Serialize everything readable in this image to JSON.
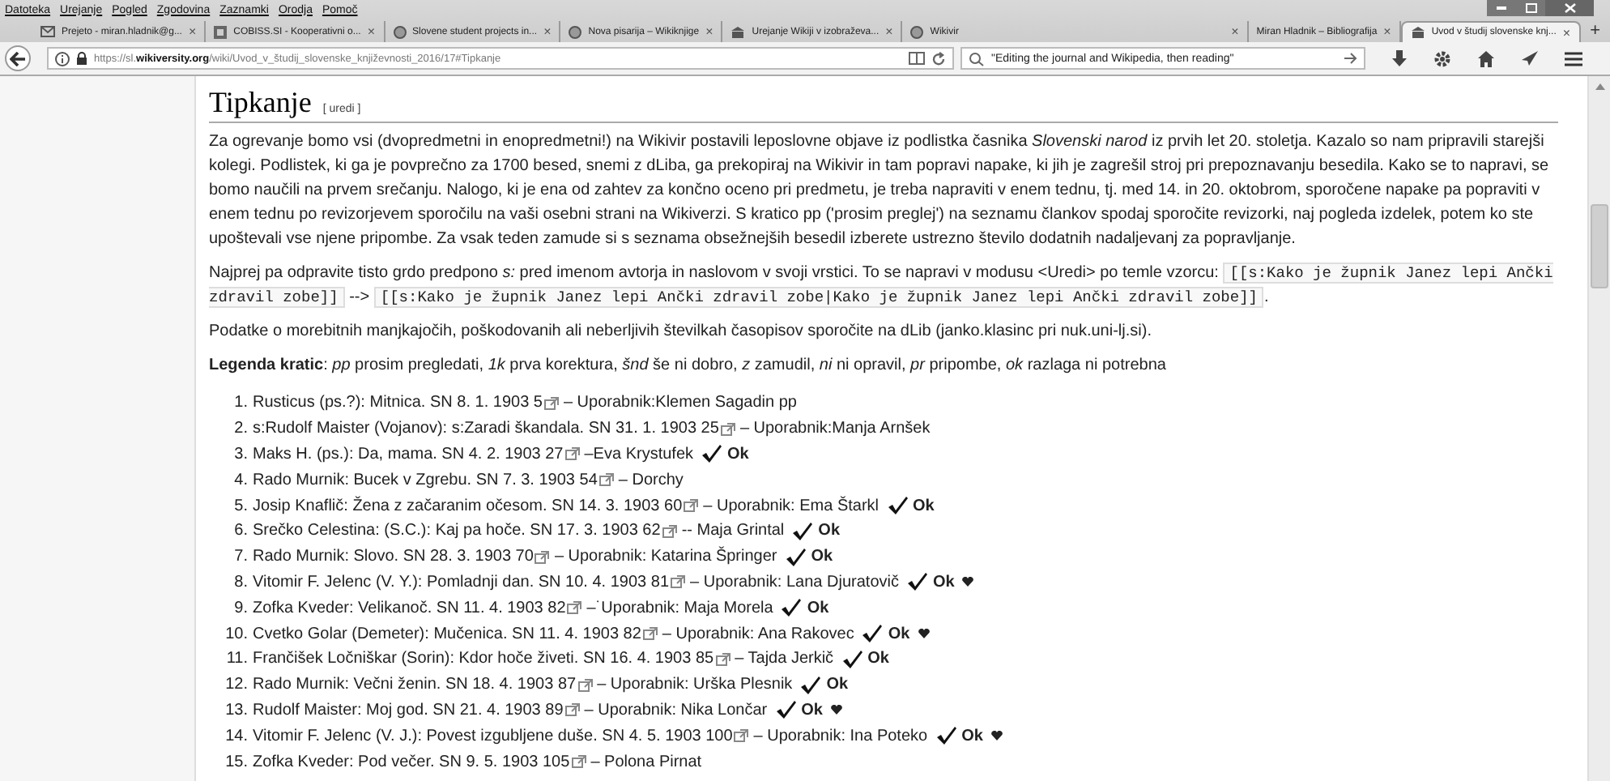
{
  "menu_bar": [
    "Datoteka",
    "Urejanje",
    "Pogled",
    "Zgodovina",
    "Zaznamki",
    "Orodja",
    "Pomoč"
  ],
  "tabs": [
    {
      "title": "Prejeto - miran.hladnik@g...",
      "selected": false
    },
    {
      "title": "COBISS.SI - Kooperativni o...",
      "selected": false
    },
    {
      "title": "Slovene student projects in...",
      "selected": false
    },
    {
      "title": "Nova pisarija – Wikiknjige",
      "selected": false
    },
    {
      "title": "Urejanje Wikiji v izobraževa...",
      "selected": false
    },
    {
      "title": "Wikivir",
      "selected": false
    },
    {
      "title": "Miran Hladnik – Bibliografija",
      "selected": false
    },
    {
      "title": "Uvod v študij slovenske knj...",
      "selected": true
    }
  ],
  "tab_close": "×",
  "new_tab": "+",
  "address_bar": {
    "url_host_prefix": "https://sl.",
    "url_host": "wikiversity.org",
    "url_path": "/wiki/Uvod_v_študij_slovenske_književnosti_2016/17#Tipkanje"
  },
  "search": {
    "value": "\"Editing the journal and Wikipedia, then reading\""
  },
  "section": {
    "title": "Tipkanje",
    "edit_link": "[ uredi ]"
  },
  "paragraphs": [
    [
      {
        "kind": "text",
        "text": "Za ogrevanje bomo vsi (dvopredmetni in enopredmetni!) na Wikivir postavili leposlovne objave iz podlistka časnika *Slovenski narod* iz prvih let 20. stoletja. Kazalo so nam pripravili starejši kolegi. Podlistek, ki ga je povprečno za 1700 besed, snemi z dLiba, ga prekopiraj na Wikivir in tam popravi napake, ki jih je zagrešil stroj pri prepoznavanju besedila. Kako se to napravi, se bomo naučili na prvem srečanju. Nalogo, ki je ena od zahtev za končno oceno pri predmetu, je treba napraviti v enem tednu, tj. med 14. in 20. oktobrom, sporočene napake pa popraviti v enem tednu po revizorjevem sporočilu na vaši osebni strani na Wikiverzi. S kratico pp ('prosim preglej') na seznamu člankov spodaj sporočite revizorki, naj pogleda izdelek, potem ko ste upoštevali vse njene pripombe. Za vsak teden zamude si s seznama obsežnejših besedil izberete ustrezno število dodatnih nadaljevanj za popravljanje."
      }
    ],
    [
      {
        "kind": "text",
        "text": "Najprej pa odpravite tisto grdo predpono *s:* pred imenom avtorja in naslovom v svoji vrstici. To se napravi v modusu <Uredi> po temle vzorcu: "
      },
      {
        "kind": "code",
        "text": "[[s:Kako je župnik Janez lepi Ančki zdravil zobe]]"
      },
      {
        "kind": "text",
        "text": " --> "
      },
      {
        "kind": "code",
        "text": "[[s:Kako je župnik Janez lepi Ančki zdravil zobe|Kako je župnik Janez lepi Ančki zdravil zobe]]"
      },
      {
        "kind": "text",
        "text": "."
      }
    ],
    [
      {
        "kind": "text",
        "text": "Podatke o morebitnih manjkajočih, poškodovanih ali neberljivih številkah časopisov sporočite na dLib (janko.klasinc pri nuk.uni-lj.si)."
      }
    ],
    [
      {
        "kind": "text",
        "text": "**Legenda kratic**: *pp* prosim pregledati, *1k* prva korektura, *šnd* še ni dobro, *z* zamudil, *ni* ni opravil, *pr* pripombe, *ok* razlaga ni potrebna"
      }
    ]
  ],
  "entries": [
    {
      "number": "1.",
      "text": "Rusticus (ps.?): Mitnica. SN 8. 1. 1903 5",
      "rest": "– Uporabnik:Klemen Sagadin pp",
      "heart": false
    },
    {
      "number": "2.",
      "text": "s:Rudolf Maister (Vojanov): s:Zaradi škandala. SN 31. 1. 1903 25",
      "rest": "– Uporabnik:Manja Arnšek",
      "heart": false
    },
    {
      "number": "3.",
      "text": "Maks H. (ps.): Da, mama. SN 4. 2. 1903 27",
      "rest": "–Eva Krystufek",
      "status": "Ok",
      "heart": false
    },
    {
      "number": "4.",
      "text": "Rado Murnik: Bucek v Zgrebu. SN 7. 3. 1903 54",
      "rest": "– Dorchy",
      "heart": false
    },
    {
      "number": "5.",
      "text": "Josip Knaflič: Žena z začaranim očesom. SN 14. 3. 1903 60",
      "rest": "– Uporabnik: Ema Štarkl",
      "status": "Ok",
      "heart": false
    },
    {
      "number": "6.",
      "text": "Srečko Celestina: (S.C.): Kaj pa hoče. SN 17. 3. 1903 62",
      "rest": "-- Maja Grintal",
      "status": "Ok",
      "heart": false
    },
    {
      "number": "7.",
      "text": "Rado Murnik: Slovo. SN 28. 3. 1903 70",
      "rest": "– Uporabnik: Katarina Špringer",
      "status": "Ok",
      "heart": false
    },
    {
      "number": "8.",
      "text": "Vitomir F. Jelenc (V. Y.): Pomladnji dan. SN 10. 4. 1903 81",
      "rest": "– Uporabnik: Lana Djuratovič",
      "status": "Ok",
      "heart": true
    },
    {
      "number": "9.",
      "text": "Zofka Kveder: Velikanoč. SN 11. 4. 1903 82",
      "rest": "–˙Uporabnik: Maja Morela",
      "status": "Ok",
      "heart": false
    },
    {
      "number": "10.",
      "text": "Cvetko Golar (Demeter): Mučenica. SN 11. 4. 1903 82",
      "rest": "– Uporabnik: Ana Rakovec",
      "status": "Ok",
      "heart": true
    },
    {
      "number": "11.",
      "text": "Frančišek Ločniškar (Sorin): Kdor hoče živeti. SN 16. 4. 1903 85",
      "rest": "– Tajda Jerkič",
      "status": "Ok",
      "heart": false
    },
    {
      "number": "12.",
      "text": "Rado Murnik: Večni ženin. SN 18. 4. 1903 87",
      "rest": "– Uporabnik: Urška Plesnik",
      "status": "Ok",
      "heart": false
    },
    {
      "number": "13.",
      "text": "Rudolf Maister: Moj god. SN 21. 4. 1903 89",
      "rest": "– Uporabnik: Nika Lončar",
      "status": "Ok",
      "heart": true
    },
    {
      "number": "14.",
      "text": "Vitomir F. Jelenc (V. J.): Povest izgubljene duše. SN 4. 5. 1903 100",
      "rest": "– Uporabnik: Ina Poteko",
      "status": "Ok",
      "heart": true
    },
    {
      "number": "15.",
      "text": "Zofka Kveder: Pod večer. SN 9. 5. 1903 105",
      "rest": "– Polona Pirnat",
      "heart": false
    }
  ]
}
